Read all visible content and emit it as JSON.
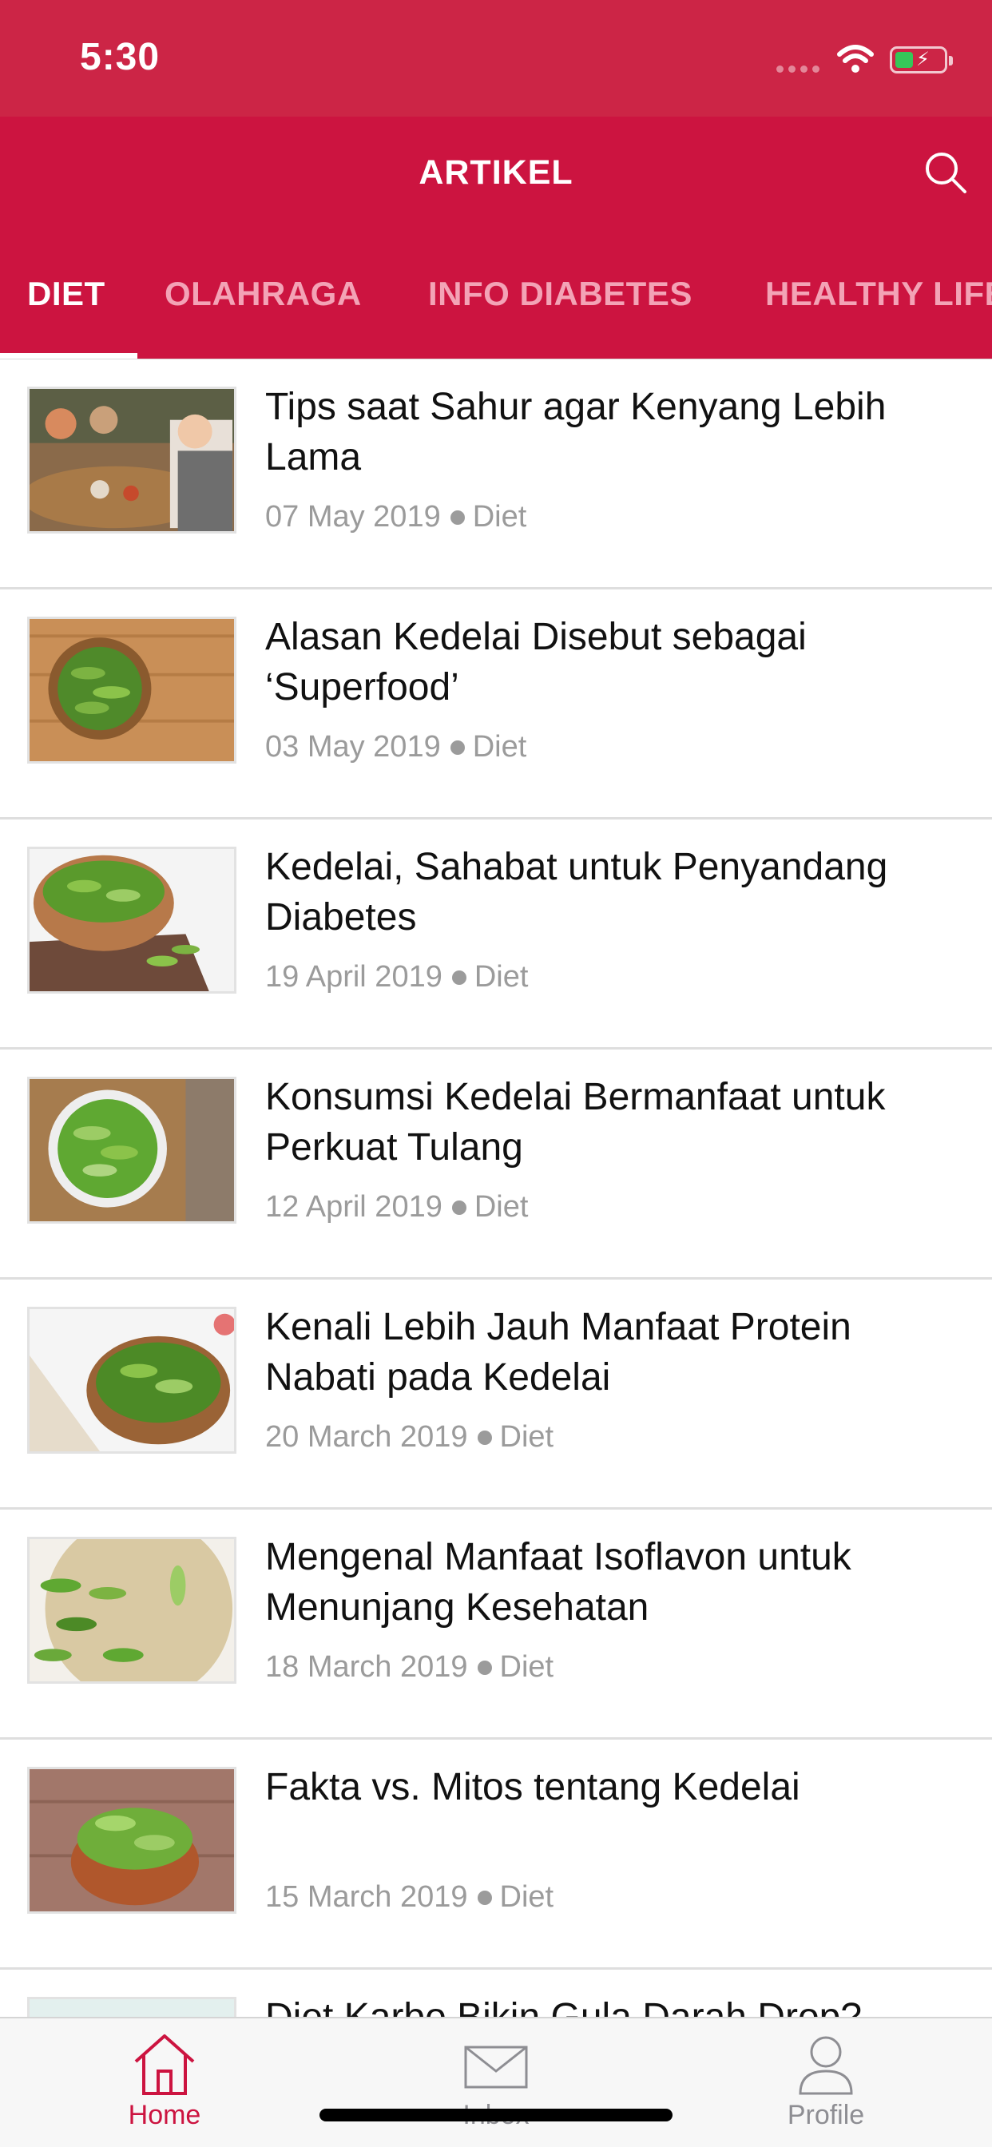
{
  "status_bar": {
    "time": "5:30"
  },
  "header": {
    "title": "ARTIKEL"
  },
  "tabs": [
    {
      "label": "DIET",
      "active": true
    },
    {
      "label": "OLAHRAGA",
      "active": false
    },
    {
      "label": "INFO DIABETES",
      "active": false
    },
    {
      "label": "HEALTHY LIFE",
      "active": false
    }
  ],
  "articles": [
    {
      "title": "Tips saat Sahur agar Kenyang Lebih Lama",
      "date": "07 May 2019",
      "category": "Diet"
    },
    {
      "title": "Alasan Kedelai Disebut sebagai ‘Superfood’",
      "date": "03 May 2019",
      "category": "Diet"
    },
    {
      "title": "Kedelai, Sahabat untuk Penyandang Diabetes",
      "date": "19 April 2019",
      "category": "Diet"
    },
    {
      "title": "Konsumsi Kedelai Bermanfaat untuk Perkuat Tulang",
      "date": "12 April 2019",
      "category": "Diet"
    },
    {
      "title": "Kenali Lebih Jauh Manfaat Protein Nabati pada Kedelai",
      "date": "20 March 2019",
      "category": "Diet"
    },
    {
      "title": "Mengenal Manfaat Isoflavon untuk Menunjang Kesehatan",
      "date": "18 March 2019",
      "category": "Diet"
    },
    {
      "title": "Fakta vs. Mitos tentang Kedelai",
      "date": "15 March 2019",
      "category": "Diet"
    },
    {
      "title": "Diet Karbo Bikin Gula Darah Drop?",
      "date": "",
      "category": ""
    }
  ],
  "bottom_nav": [
    {
      "label": "Home",
      "icon": "home-icon",
      "active": true
    },
    {
      "label": "Inbox",
      "icon": "inbox-icon",
      "active": false
    },
    {
      "label": "Profile",
      "icon": "profile-icon",
      "active": false
    }
  ],
  "colors": {
    "primary": "#cc1440",
    "status_bar": "#cc2546",
    "active_tab_text": "#ffffff",
    "inactive_tab_text": "#f3a3b6"
  }
}
